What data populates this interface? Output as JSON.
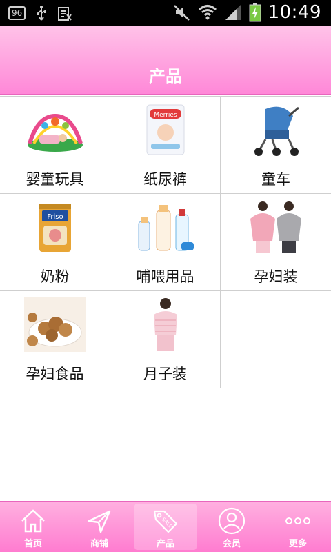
{
  "status_bar": {
    "badge": "96",
    "time": "10:49"
  },
  "header": {
    "title": "产品"
  },
  "grid": {
    "items": [
      {
        "label": "婴童玩具",
        "icon": "baby-play-gym"
      },
      {
        "label": "纸尿裤",
        "icon": "diaper-pack"
      },
      {
        "label": "童车",
        "icon": "stroller"
      },
      {
        "label": "奶粉",
        "icon": "milk-powder-can"
      },
      {
        "label": "哺喂用品",
        "icon": "feeding-bottles"
      },
      {
        "label": "孕妇装",
        "icon": "maternity-clothes"
      },
      {
        "label": "孕妇食品",
        "icon": "walnuts"
      },
      {
        "label": "月子装",
        "icon": "postnatal-wear"
      }
    ]
  },
  "bottom_nav": {
    "items": [
      {
        "label": "首页",
        "icon": "home-icon"
      },
      {
        "label": "商铺",
        "icon": "send-icon"
      },
      {
        "label": "产品",
        "icon": "sale-tag-icon",
        "active": true
      },
      {
        "label": "会员",
        "icon": "user-icon"
      },
      {
        "label": "更多",
        "icon": "more-icon"
      }
    ]
  },
  "colors": {
    "header_top": "#ffc2e8",
    "header_bottom": "#ff88d8",
    "nav_top": "#ffb0e0",
    "nav_bottom": "#ff7cd0"
  }
}
